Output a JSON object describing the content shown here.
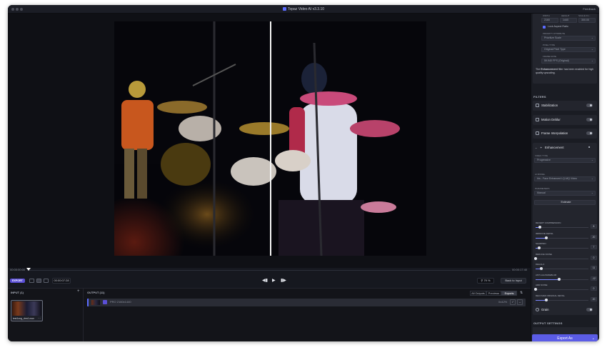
{
  "app": {
    "title": "Topaz Video AI  v3.3.10",
    "feedback": "Feedback"
  },
  "sidebar_top": {
    "width_label": "WIDTH",
    "height_label": "HEIGHT",
    "scale_label": "SCALE FU...",
    "width_value": "2160",
    "height_value": "1440",
    "scale_value": "300.00",
    "lock_aspect": "Lock Aspect Ratio",
    "priority_label": "PRIORITY ATTRIBUTE",
    "priority_value": "Prioritize Scale",
    "pixel_label": "PIXEL TYPE",
    "pixel_value": "Original Pixel Type",
    "frame_label": "FRAME RATE",
    "frame_value": "59.940 FPS (Original)",
    "note_bold": "Enhancement",
    "note_pre": "The ",
    "note_post": " filter has been enabled for high quality upscaling."
  },
  "filters": {
    "title": "FILTERS",
    "stabilization": "Stabilization",
    "motion_deblur": "Motion Deblur",
    "frame_interpolation": "Frame Interpolation",
    "enhancement": "Enhancement",
    "video_type_label": "VIDEO TYPE",
    "video_type_value": "Progressive",
    "ai_model_label": "AI MODEL",
    "ai_model_value": "Iris - Face Enhanced LQ-MQ Video",
    "parameters_label": "PARAMETERS",
    "parameters_value": "Manual",
    "estimate": "Estimate",
    "grain": "Grain"
  },
  "sliders": [
    {
      "label": "REVERT COMPRESSION",
      "value": "8",
      "pct": 0.08
    },
    {
      "label": "IMPROVE DETAIL",
      "value": "20",
      "pct": 0.2
    },
    {
      "label": "SHARPEN",
      "value": "7",
      "pct": 0.07
    },
    {
      "label": "REDUCE NOISE",
      "value": "0",
      "pct": 0.0
    },
    {
      "label": "DEHALO",
      "value": "11",
      "pct": 0.11
    },
    {
      "label": "ANTI-ALIAS/DEBLUR",
      "value": "-12",
      "pct": 0.44
    },
    {
      "label": "ADD NOISE",
      "value": "0",
      "pct": 0.0
    },
    {
      "label": "RECOVER ORIGINAL DETAIL",
      "value": "20",
      "pct": 0.2
    }
  ],
  "output_settings": {
    "title": "OUTPUT SETTINGS",
    "export_label": "Export As"
  },
  "timeline": {
    "start": "00:00:00:00",
    "end": "00:00:17:40",
    "export_chip": "EXPORT",
    "current_time": "00:00:07:28",
    "zoom": "79 %",
    "back_to_input": "Back to Input"
  },
  "input": {
    "title": "INPUT (1)",
    "file": "test1ong_drm1.mov"
  },
  "output": {
    "title": "OUTPUT (11)",
    "tabs": [
      "All Outputs",
      "Previews",
      "Exports"
    ],
    "row_info": "PRO 2160x1440",
    "row_pct": "0x42%"
  },
  "colors": {
    "accent": "#5b5ce6",
    "background": "#16181f",
    "panel": "#1a1c23"
  }
}
